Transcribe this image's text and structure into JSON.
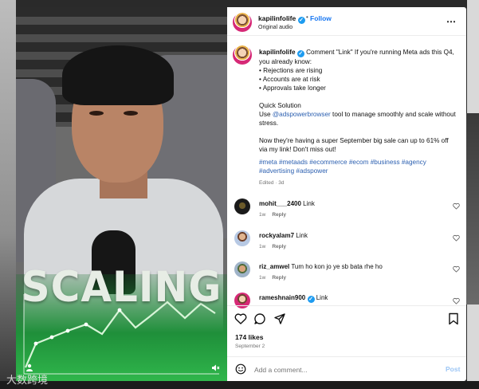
{
  "video": {
    "overlay_text": "SCALING",
    "watermark": "大数跨境",
    "icons": {
      "profile": "user-icon",
      "sound": "mute-icon"
    }
  },
  "header": {
    "username": "kapilinfolife",
    "follow_label": "Follow",
    "audio_label": "Original audio",
    "more_icon": "more-icon"
  },
  "caption": {
    "username": "kapilinfolife",
    "intro": "Comment \"Link\" If you're running Meta ads this Q4, you already know:",
    "bullets": [
      "• Rejections are rising",
      "• Accounts are at risk",
      "• Approvals take longer"
    ],
    "solution_title": "Quick Solution",
    "use_prefix": "Use ",
    "mention": "@adspowerbrowser",
    "use_suffix": " tool to manage smoothly and scale without stress.",
    "sale_text": "Now they're having a super September big sale can up to 61% off via my link! Don't miss out!",
    "hashtags": "#meta #metaads #ecommerce #ecom #business #agency #advertising #adspower",
    "edited": "Edited · 3d"
  },
  "comments": [
    {
      "username": "mohit___2400",
      "text": "Link",
      "age": "1w",
      "reply": "Reply",
      "verified": false
    },
    {
      "username": "rockyalam7",
      "text": "Link",
      "age": "1w",
      "reply": "Reply",
      "verified": false
    },
    {
      "username": "riz_amwel",
      "text": "Tum ho kon jo ye sb bata rhe ho",
      "age": "1w",
      "reply": "Reply",
      "verified": false
    },
    {
      "username": "rameshnain900",
      "text": "Link",
      "age": "",
      "reply": "",
      "verified": true
    }
  ],
  "footer": {
    "likes": "174 likes",
    "date": "September 2",
    "comment_placeholder": "Add a comment...",
    "post_label": "Post"
  },
  "colors": {
    "link_blue": "#1877f2",
    "hashtag_blue": "#2b5fb0",
    "verified_blue": "#1d9bf0",
    "chart_green": "#2fb64b"
  }
}
